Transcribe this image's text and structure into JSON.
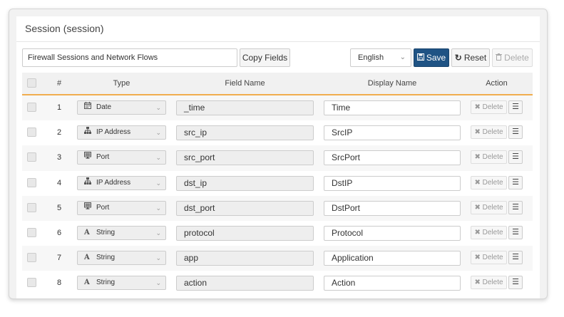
{
  "panel": {
    "title": "Session (session)"
  },
  "toolbar": {
    "name_value": "Firewall Sessions and Network Flows",
    "copy_label": "Copy Fields",
    "language": "English",
    "save_label": "Save",
    "reset_label": "Reset",
    "delete_label": "Delete"
  },
  "table": {
    "columns": {
      "num": "#",
      "type": "Type",
      "field": "Field Name",
      "display": "Display Name",
      "action": "Action"
    },
    "row_delete_label": "Delete",
    "rows": [
      {
        "num": "1",
        "type": "Date",
        "type_icon": "calendar-icon",
        "field": "_time",
        "display": "Time"
      },
      {
        "num": "2",
        "type": "IP Address",
        "type_icon": "network-icon",
        "field": "src_ip",
        "display": "SrcIP"
      },
      {
        "num": "3",
        "type": "Port",
        "type_icon": "monitor-icon",
        "field": "src_port",
        "display": "SrcPort"
      },
      {
        "num": "4",
        "type": "IP Address",
        "type_icon": "network-icon",
        "field": "dst_ip",
        "display": "DstIP"
      },
      {
        "num": "5",
        "type": "Port",
        "type_icon": "monitor-icon",
        "field": "dst_port",
        "display": "DstPort"
      },
      {
        "num": "6",
        "type": "String",
        "type_icon": "letter-a-icon",
        "field": "protocol",
        "display": "Protocol"
      },
      {
        "num": "7",
        "type": "String",
        "type_icon": "letter-a-icon",
        "field": "app",
        "display": "Application"
      },
      {
        "num": "8",
        "type": "String",
        "type_icon": "letter-a-icon",
        "field": "action",
        "display": "Action"
      }
    ]
  },
  "colors": {
    "save_button": "#1f5384",
    "header_underline": "#f0ad4e"
  }
}
